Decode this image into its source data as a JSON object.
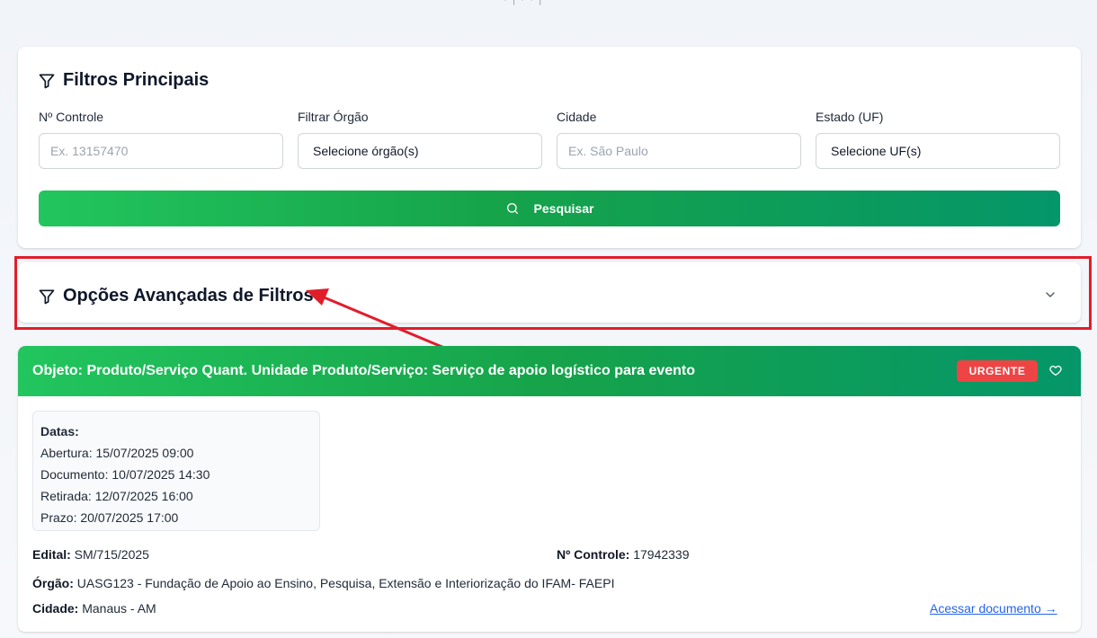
{
  "filters": {
    "title": "Filtros Principais",
    "fields": [
      {
        "label": "Nº Controle",
        "placeholder": "Ex. 13157470"
      },
      {
        "label": "Filtrar Órgão",
        "value": "Selecione órgão(s)"
      },
      {
        "label": "Cidade",
        "placeholder": "Ex. São Paulo"
      },
      {
        "label": "Estado (UF)",
        "value": "Selecione UF(s)"
      }
    ],
    "search_label": "Pesquisar"
  },
  "advanced": {
    "title": "Opções Avançadas de Filtros"
  },
  "result": {
    "title": "Objeto: Produto/Serviço Quant. Unidade Produto/Serviço: Serviço de apoio logístico para evento",
    "badge": "URGENTE",
    "dates": {
      "title": "Datas:",
      "abertura": "Abertura: 15/07/2025 09:00",
      "documento": "Documento: 10/07/2025 14:30",
      "retirada": "Retirada: 12/07/2025 16:00",
      "prazo": "Prazo: 20/07/2025 17:00"
    },
    "edital_label": "Edital:",
    "edital_value": "SM/715/2025",
    "controle_label": "Nº Controle:",
    "controle_value": "17942339",
    "orgao_label": "Órgão:",
    "orgao_value": "UASG123 - Fundação de Apoio ao Ensino, Pesquisa, Extensão e Interiorização do IFAM- FAEPI",
    "cidade_label": "Cidade:",
    "cidade_value": "Manaus - AM",
    "link_label": "Acessar documento →"
  },
  "colors": {
    "primary_green": "#16a34a",
    "urgent_red": "#ef4444",
    "highlight_red": "#e11d2a",
    "link_blue": "#2563eb"
  },
  "icons": {
    "filter": "filter-icon",
    "search": "search-icon",
    "chevron": "chevron-down-icon",
    "heart": "heart-icon"
  }
}
